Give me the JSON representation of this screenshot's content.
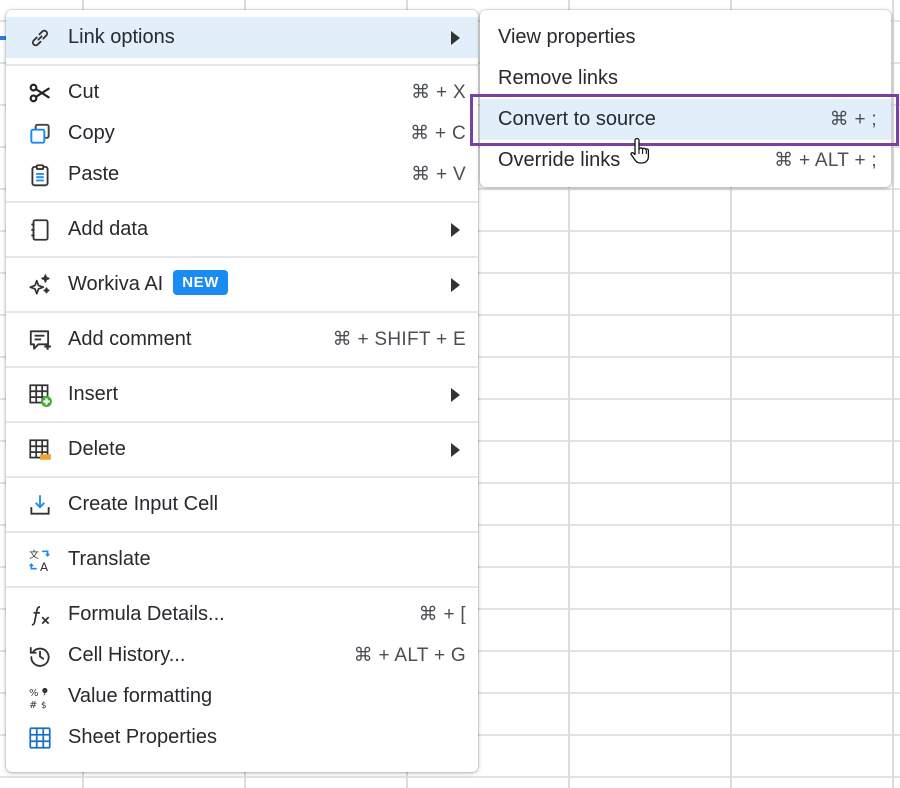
{
  "menu": {
    "link_options": "Link options",
    "cut": "Cut",
    "cut_shortcut": "⌘ + X",
    "copy": "Copy",
    "copy_shortcut": "⌘ + C",
    "paste": "Paste",
    "paste_shortcut": "⌘ + V",
    "add_data": "Add data",
    "workiva_ai": "Workiva AI",
    "workiva_ai_badge": "NEW",
    "add_comment": "Add comment",
    "add_comment_shortcut": "⌘ + SHIFT + E",
    "insert": "Insert",
    "delete": "Delete",
    "create_input_cell": "Create Input Cell",
    "translate": "Translate",
    "formula_details": "Formula Details...",
    "formula_details_shortcut": "⌘ + [",
    "cell_history": "Cell History...",
    "cell_history_shortcut": "⌘ + ALT + G",
    "value_formatting": "Value formatting",
    "sheet_properties": "Sheet Properties"
  },
  "submenu": {
    "view_properties": "View properties",
    "remove_links": "Remove links",
    "convert_to_source": "Convert to source",
    "convert_to_source_shortcut": "⌘ + ;",
    "override_links": "Override links",
    "override_links_shortcut": "⌘ + ALT + ;"
  },
  "colors": {
    "highlight": "#e2effb",
    "badge": "#1a8bf0",
    "focus_outline": "#7b3fa6",
    "insert_icon_accent": "#3fae2a",
    "delete_icon_accent": "#f0a22e",
    "copy_icon_accent": "#1a8bf0"
  },
  "icons": [
    "link-icon",
    "scissors-icon",
    "copy-icon",
    "clipboard-icon",
    "notebook-icon",
    "sparkle-icon",
    "comment-icon",
    "insert-table-icon",
    "delete-table-icon",
    "input-cell-icon",
    "translate-icon",
    "formula-icon",
    "history-icon",
    "value-format-icon",
    "table-icon",
    "hand-cursor-icon"
  ]
}
